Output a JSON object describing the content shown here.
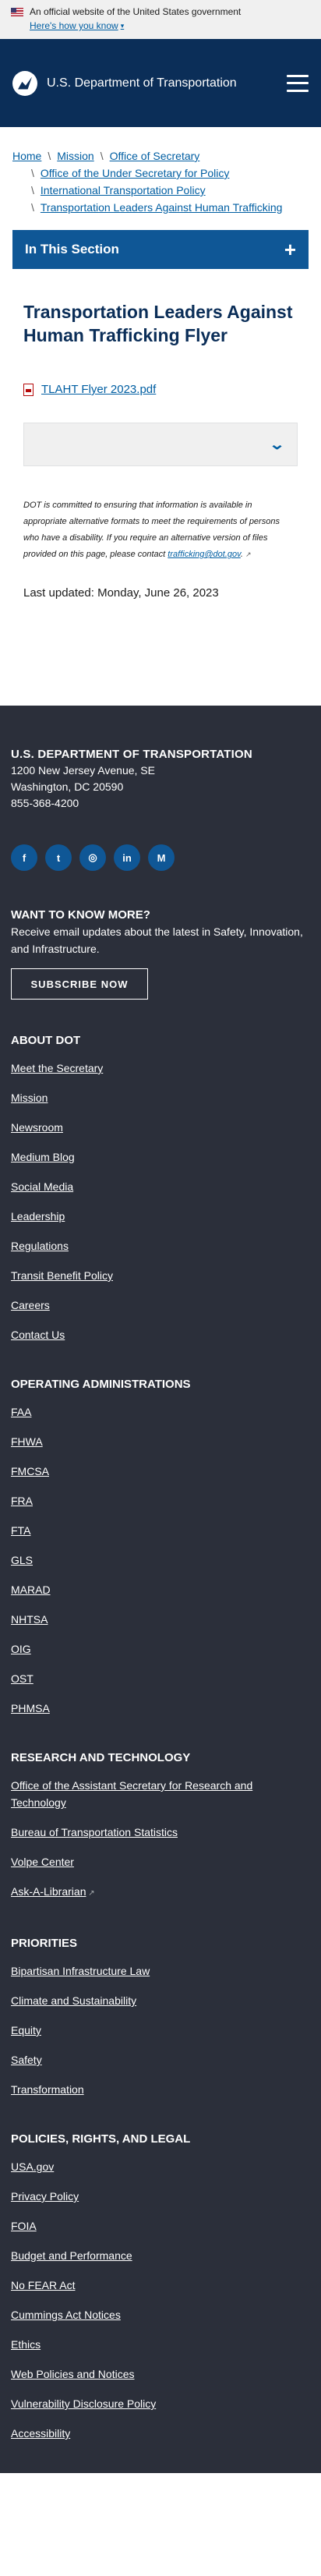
{
  "gov_banner": {
    "text": "An official website of the United States government",
    "link": "Here's how you know"
  },
  "header": {
    "brand": "U.S. Department of Transportation"
  },
  "breadcrumb": {
    "items": [
      "Home",
      "Mission",
      "Office of Secretary",
      "Office of the Under Secretary for Policy",
      "International Transportation Policy",
      "Transportation Leaders Against Human Trafficking"
    ]
  },
  "section_nav": {
    "label": "In This Section",
    "toggle": "+"
  },
  "main": {
    "title": "Transportation Leaders Against Human Trafficking Flyer",
    "file_link": "TLAHT Flyer 2023.pdf",
    "note_text": "DOT is committed to ensuring that information is available in appropriate alternative formats to meet the requirements of persons who have a disability. If you require an alternative version of files provided on this page, please contact ",
    "note_email": "trafficking@dot.gov",
    "note_end": ".",
    "last_updated": "Last updated: Monday, June 26, 2023"
  },
  "footer": {
    "agency": "U.S. Department of Transportation",
    "address1": "1200 New Jersey Avenue, SE",
    "address2": "Washington, DC 20590",
    "phone": "855-368-4200",
    "socials": [
      {
        "icon": "facebook-icon",
        "glyph": "f"
      },
      {
        "icon": "twitter-icon",
        "glyph": "t"
      },
      {
        "icon": "instagram-icon",
        "glyph": "◎"
      },
      {
        "icon": "linkedin-icon",
        "glyph": "in"
      },
      {
        "icon": "medium-icon",
        "glyph": "M"
      }
    ],
    "want_to_know": "Want to know more?",
    "want_text": "Receive email updates about the latest in Safety, Innovation, and Infrastructure.",
    "subscribe": "Subscribe Now",
    "groups": [
      {
        "title": "About DOT",
        "links": [
          "Meet the Secretary",
          "Mission",
          "Newsroom",
          "Medium Blog",
          "Social Media",
          "Leadership",
          "Regulations",
          "Transit Benefit Policy",
          "Careers",
          "Contact Us"
        ]
      },
      {
        "title": "Operating Administrations",
        "links": [
          "FAA",
          "FHWA",
          "FMCSA",
          "FRA",
          "FTA",
          "GLS",
          "MARAD",
          "NHTSA",
          "OIG",
          "OST",
          "PHMSA"
        ]
      },
      {
        "title": "Research and Technology",
        "links": [
          "Office of the Assistant Secretary for Research and Technology",
          "Bureau of Transportation Statistics",
          "Volpe Center",
          "Ask-A-Librarian"
        ]
      },
      {
        "title": "Priorities",
        "links": [
          "Bipartisan Infrastructure Law",
          "Climate and Sustainability",
          "Equity",
          "Safety",
          "Transformation"
        ]
      },
      {
        "title": "Policies, Rights, and Legal",
        "links": [
          "USA.gov",
          "Privacy Policy",
          "FOIA",
          "Budget and Performance",
          "No FEAR Act",
          "Cummings Act Notices",
          "Ethics",
          "Web Policies and Notices",
          "Vulnerability Disclosure Policy",
          "Accessibility"
        ]
      }
    ]
  },
  "colors": {
    "header_bg": "#0b2e58",
    "section_bar": "#0f5796",
    "link": "#005ea2",
    "footer_bg": "#2b2f3a"
  }
}
